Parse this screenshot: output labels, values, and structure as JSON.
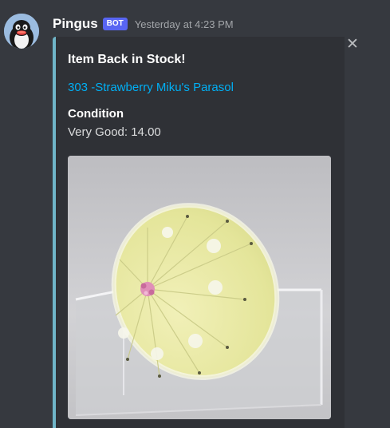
{
  "message": {
    "author": "Pingus",
    "bot_tag": "BOT",
    "timestamp": "Yesterday at 4:23 PM",
    "avatar_icon": "penguin-avatar-icon",
    "close_icon": "close-icon",
    "close_glyph": "✕"
  },
  "embed": {
    "accent_color": "#6fb5c8",
    "title": "Item Back in Stock!",
    "link_text": "303 -Strawberry Miku's Parasol",
    "field_name": "Condition",
    "field_value": "Very Good: 14.00",
    "image_icon": "parasol-product-image"
  }
}
